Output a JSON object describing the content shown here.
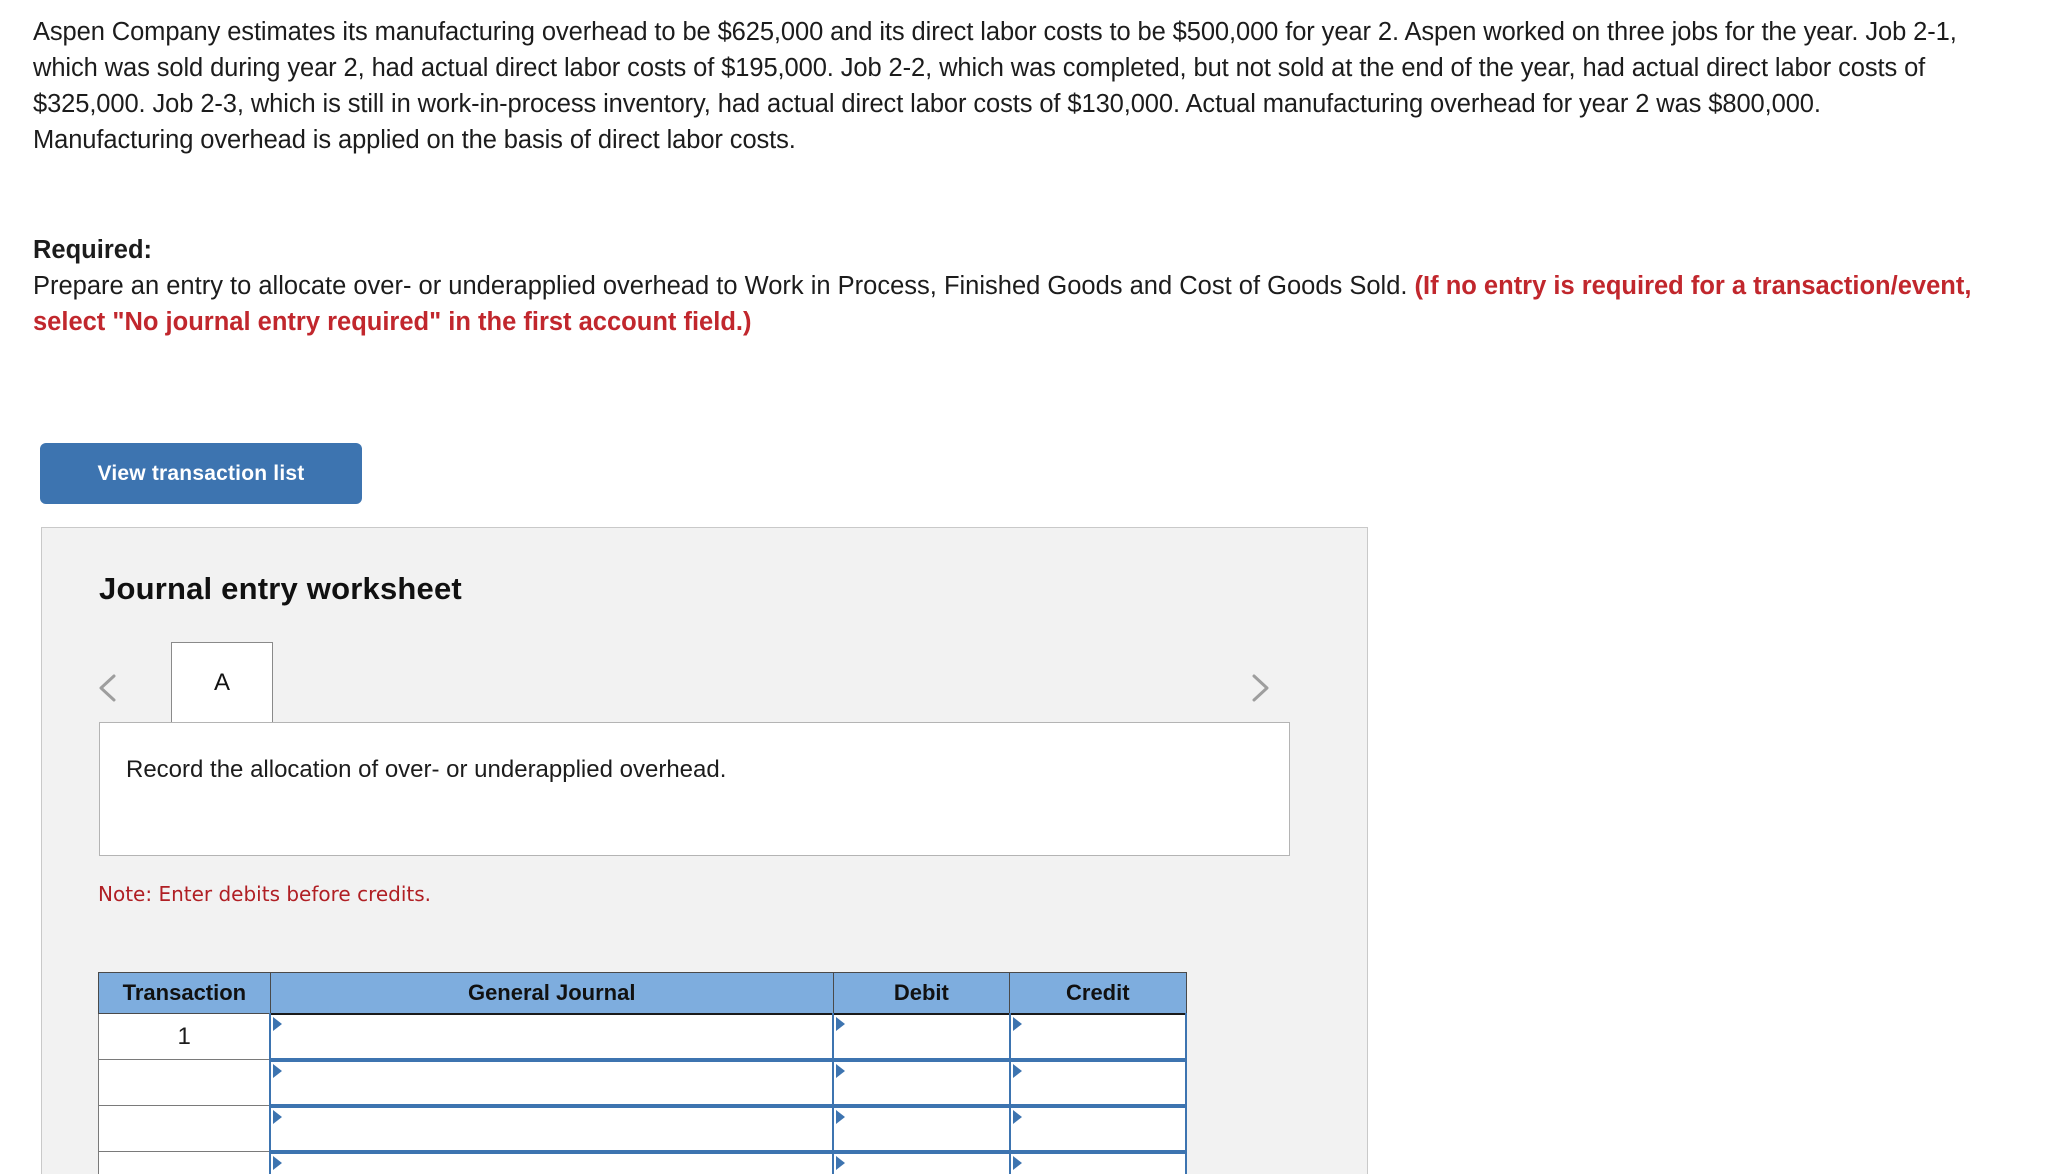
{
  "problem": {
    "paragraph": "Aspen Company estimates its manufacturing overhead to be $625,000 and its direct labor costs to be $500,000 for year 2. Aspen worked on three jobs for the year. Job 2-1, which was sold during year 2, had actual direct labor costs of $195,000. Job 2-2, which was completed, but not sold at the end of the year, had actual direct labor costs of $325,000. Job 2-3, which is still in work-in-process inventory, had actual direct labor costs of $130,000. Actual manufacturing overhead for year 2 was $800,000. Manufacturing overhead is applied on the basis of direct labor costs."
  },
  "required": {
    "label": "Required:",
    "instruction": "Prepare an entry to allocate over- or underapplied overhead to Work in Process, Finished Goods and Cost of Goods Sold. ",
    "emphasis": "(If no entry is required for a transaction/event, select \"No journal entry required\" in the first account field.)"
  },
  "toolbar": {
    "view_transaction_list_label": "View transaction list"
  },
  "worksheet": {
    "title": "Journal entry worksheet",
    "prev_icon": "chevron-left-icon",
    "next_icon": "chevron-right-icon",
    "tabs": [
      {
        "label": "A",
        "selected": true
      }
    ],
    "description": "Record the allocation of over- or underapplied overhead.",
    "note": "Note: Enter debits before credits.",
    "table": {
      "columns": [
        "Transaction",
        "General Journal",
        "Debit",
        "Credit"
      ],
      "rows": [
        {
          "transaction": "1",
          "general_journal": "",
          "debit": "",
          "credit": ""
        },
        {
          "transaction": "",
          "general_journal": "",
          "debit": "",
          "credit": ""
        },
        {
          "transaction": "",
          "general_journal": "",
          "debit": "",
          "credit": ""
        },
        {
          "transaction": "",
          "general_journal": "",
          "debit": "",
          "credit": ""
        }
      ]
    }
  },
  "colors": {
    "button_blue": "#3d74b0",
    "header_blue": "#7eadde",
    "note_red": "#b01f24",
    "emphasis_red": "#c1272d",
    "panel_gray": "#f2f2f2"
  }
}
